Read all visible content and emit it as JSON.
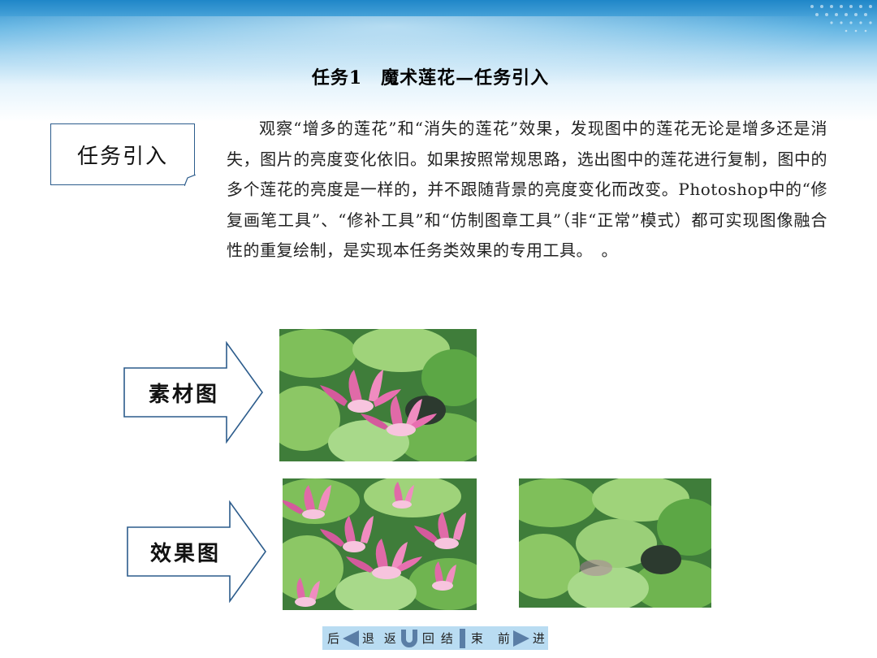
{
  "title": "任务1　魔术莲花—任务引入",
  "tag": {
    "label": "任务引入"
  },
  "paragraph": "观察“增多的莲花”和“消失的莲花”效果，发现图中的莲花无论是增多还是消失，图片的亮度变化依旧。如果按照常规思路，选出图中的莲花进行复制，图中的多个莲花的亮度是一样的，并不跟随背景的亮度变化而改变。Photoshop中的“修复画笔工具”、“修补工具”和“仿制图章工具”（非“正常”模式）都可实现图像融合性的重复绘制，是实现本任务类效果的专用工具。　。",
  "source_label": "素材图",
  "result_label": "效果图",
  "nav": {
    "back_1": "后",
    "back_2": "退",
    "return_1": "返",
    "return_2": "回",
    "end_1": "结",
    "end_2": "束",
    "forward_1": "前",
    "forward_2": "进"
  },
  "colors": {
    "band": "#1f86c8",
    "arrow_stroke": "#2c5c8c",
    "nav_bg": "#b9dcf2",
    "nav_icon": "#5a7ea6"
  },
  "icons": [
    "back-arrow-icon",
    "u-turn-icon",
    "end-bar-icon",
    "forward-arrow-icon"
  ]
}
